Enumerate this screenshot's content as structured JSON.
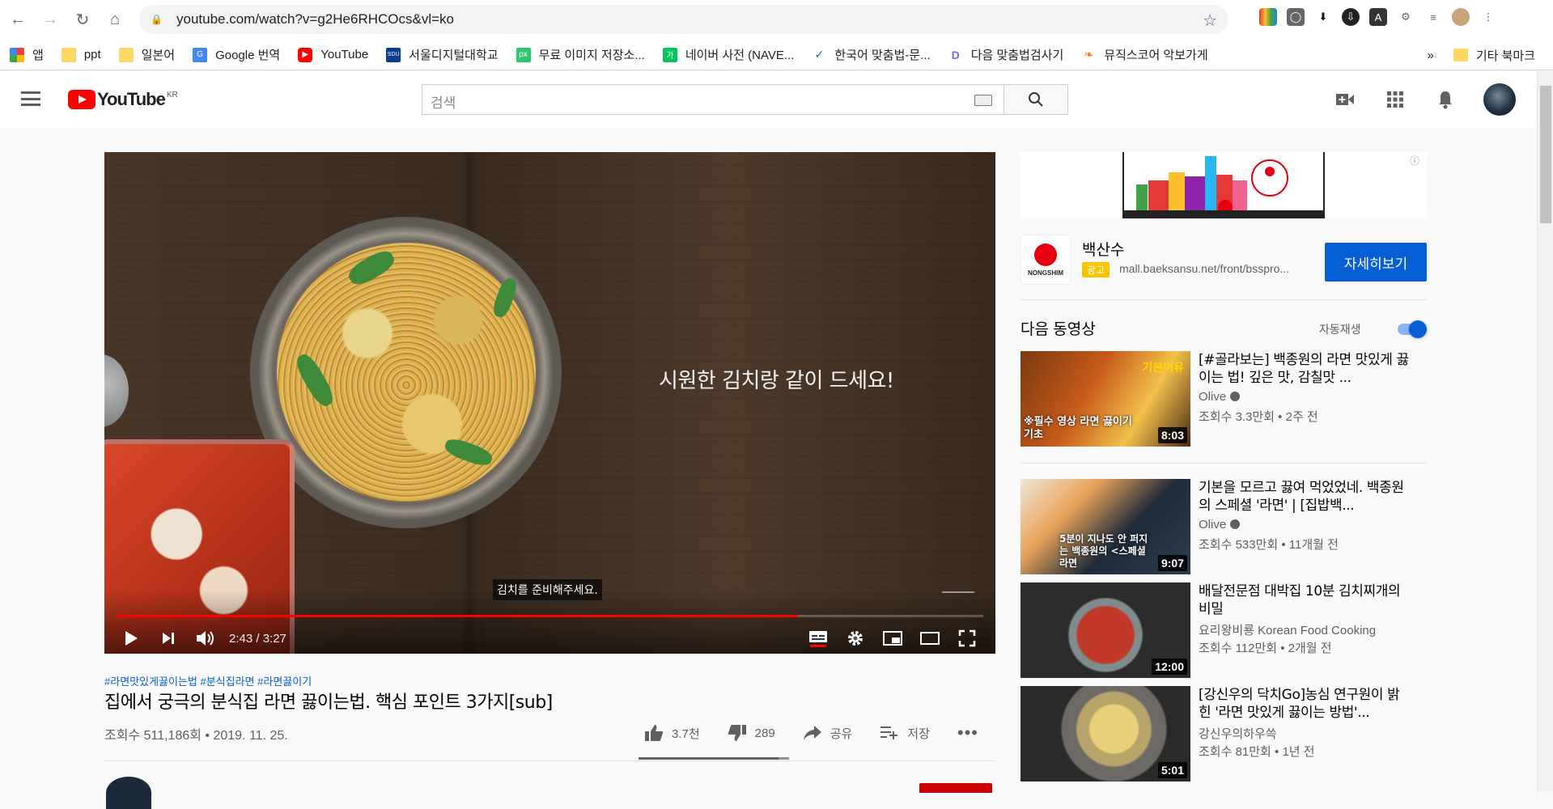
{
  "browser": {
    "url": "youtube.com/watch?v=g2He6RHCOcs&vl=ko",
    "bookmarks": [
      "앱",
      "ppt",
      "일본어",
      "Google 번역",
      "YouTube",
      "서울디지털대학교",
      "무료 이미지 저장소...",
      "네이버 사전 (NAVE...",
      "한국어 맞춤법-문...",
      "다음 맞춤법검사기",
      "뮤직스코어 악보가게"
    ],
    "bookmarks_more": "»",
    "other_bookmarks": "기타 북마크"
  },
  "masthead": {
    "logo_text": "YouTube",
    "region": "KR",
    "search_placeholder": "검색"
  },
  "player": {
    "overlay_text": "시원한 김치랑 같이 드세요!",
    "caption": "김치를 준비해주세요.",
    "time": "2:43 / 3:27",
    "progress": 0.786
  },
  "video": {
    "hashtags": "#라면맛있게끓이는법 #분식집라면 #라면끓이기",
    "title": "집에서 궁극의 분식집 라면 끓이는법. 핵심 포인트 3가지[sub]",
    "meta": "조회수 511,186회 • 2019. 11. 25.",
    "likes": "3.7천",
    "dislikes": "289",
    "share": "공유",
    "save": "저장",
    "like_ratio": 0.93
  },
  "ad": {
    "advertiser": "백산수",
    "logo_text": "NONGSHIM",
    "tag": "광고",
    "url": "mall.baeksansu.net/front/bsspro...",
    "cta": "자세히보기",
    "info": "ⓘ"
  },
  "sidebar": {
    "up_next": "다음 동영상",
    "autoplay": "자동재생",
    "items": [
      {
        "title": "[#골라보는] 백종원의 라면 맛있게 끓이는 법! 깊은 맛, 감칠맛 ...",
        "channel": "Olive",
        "verified": true,
        "views": "조회수 3.3만회 • 2주 전",
        "duration": "8:03",
        "thumb_text": "※필수 영상 라면 끓이기 기초",
        "thumb_tag": "기본이유"
      },
      {
        "title": "기본을 모르고 끓여 먹었었네. 백종원의 스페셜 '라면' | [집밥백...",
        "channel": "Olive",
        "verified": true,
        "views": "조회수 533만회 • 11개월 전",
        "duration": "9:07",
        "thumb_text": "5분이 지나도 안 퍼지는 백종원의 <스페셜 라면"
      },
      {
        "title": "배달전문점 대박집 10분 김치찌개의 비밀",
        "channel": "요리왕비룡 Korean Food Cooking",
        "verified": false,
        "views": "조회수 112만회 • 2개월 전",
        "duration": "12:00"
      },
      {
        "title": "[강신우의 닥치Go]농심 연구원이 밝힌 '라면 맛있게 끓이는 방법'...",
        "channel": "강신우의하우쓱",
        "verified": false,
        "views": "조회수 81만회 • 1년 전",
        "duration": "5:01"
      }
    ]
  },
  "colors": {
    "brand_red": "#ff0000",
    "link_blue": "#065fd4",
    "ad_yellow": "#f9c400"
  }
}
